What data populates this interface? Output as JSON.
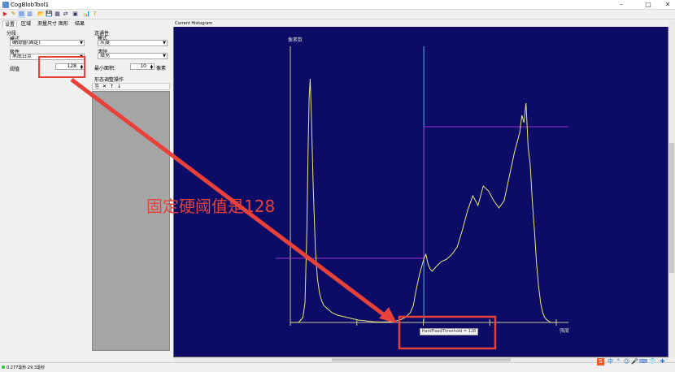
{
  "window": {
    "title": "CogBlobTool1",
    "minimize": "–",
    "maximize": "□",
    "close": "✕"
  },
  "toolbar": {
    "icons": [
      "run-icon",
      "edit-icon",
      "image-icon",
      "image-2-icon",
      "open-icon",
      "save-icon",
      "stack-icon",
      "export-icon",
      "graph-icon",
      "chart-icon",
      "help-icon"
    ],
    "glyphs": [
      "▶",
      "✎",
      "▤",
      "▥",
      "📂",
      "💾",
      "▦",
      "⇄",
      "▣",
      "📊",
      "?"
    ]
  },
  "tabs": [
    "设置",
    "区域",
    "测量尺寸",
    "图形",
    "结果"
  ],
  "segmentation": {
    "group_label": "分段",
    "mode_label": "模式",
    "mode_value": "硬阈值(固定)",
    "polarity_label": "极性",
    "polarity_value": "黑底白点",
    "threshold_label": "阈值",
    "threshold_value": "128"
  },
  "connectivity": {
    "group_label": "连通性",
    "mode_label": "模式",
    "mode_value": "灰度",
    "cleanup_label": "清除",
    "cleanup_value": "填充",
    "min_area_label": "最小面积:",
    "min_area_value": "10",
    "min_area_unit": "像素"
  },
  "morph": {
    "label": "形态调整操作",
    "tool_glyphs": [
      "⎘",
      "✕",
      "↑",
      "↓"
    ]
  },
  "histogram": {
    "header": "Current Histogram",
    "y_label": "像素数",
    "x_label": "强度",
    "tooltip": "HardFixedThreshold = 128"
  },
  "annotation": "固定硬阈值是128",
  "status": {
    "text": "0.277毫秒 29.3毫秒"
  },
  "tray": {
    "glyphs": [
      "S",
      "中",
      "°",
      "☺",
      "🎤",
      "⌨",
      "👕",
      "✚"
    ]
  },
  "colors": {
    "hist_bg": "#0c0c66",
    "curve": "#e8e87a",
    "threshold": "#48c0e8",
    "annotation": "#e8413a"
  },
  "chart_data": {
    "type": "line",
    "x": [
      0,
      4,
      8,
      12,
      14,
      16,
      17,
      18,
      19,
      20,
      22,
      24,
      26,
      28,
      30,
      32,
      36,
      40,
      45,
      50,
      55,
      60,
      65,
      70,
      75,
      80,
      85,
      90,
      95,
      100,
      105,
      110,
      115,
      118,
      120,
      122,
      124,
      126,
      128,
      130,
      132,
      134,
      136,
      138,
      140,
      145,
      150,
      155,
      160,
      165,
      170,
      175,
      180,
      185,
      190,
      195,
      200,
      205,
      210,
      215,
      220,
      222,
      224,
      226,
      228,
      230,
      232,
      234,
      236,
      238,
      240,
      242,
      244,
      246,
      248,
      250,
      252,
      254,
      255
    ],
    "values": [
      0,
      0,
      0,
      2,
      8,
      40,
      70,
      92,
      100,
      88,
      55,
      30,
      18,
      12,
      9,
      7,
      5.5,
      4,
      3,
      2.5,
      2,
      1.5,
      1,
      0.8,
      0.5,
      0.3,
      0.2,
      0.2,
      0.3,
      0.5,
      1,
      2,
      4,
      7,
      12,
      16,
      20,
      23,
      26,
      28,
      24,
      22,
      21,
      22,
      23,
      25,
      26,
      28,
      31,
      38,
      46,
      52,
      48,
      56,
      54,
      50,
      47,
      50,
      60,
      70,
      78,
      85,
      82,
      90,
      72,
      65,
      50,
      38,
      25,
      15,
      8,
      4,
      2,
      1,
      0.5,
      0,
      0,
      0,
      0
    ],
    "xlim": [
      0,
      255
    ],
    "ylim": [
      0,
      110
    ],
    "threshold": 128,
    "xlabel": "强度",
    "ylabel": "像素数"
  }
}
